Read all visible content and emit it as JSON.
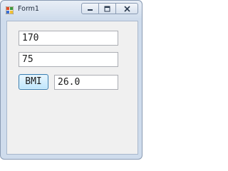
{
  "window": {
    "title": "Form1"
  },
  "titlebar_buttons": {
    "minimize_icon": "minimize-icon",
    "maximize_icon": "maximize-icon",
    "close_icon": "close-icon"
  },
  "form": {
    "height_value": "170",
    "weight_value": "75",
    "bmi_button_label": "BMI",
    "result_value": "26.0"
  },
  "colors": {
    "titlebar": "#cfdcec",
    "client_background": "#f0f0f0",
    "button_accent": "#3c7fb1"
  }
}
